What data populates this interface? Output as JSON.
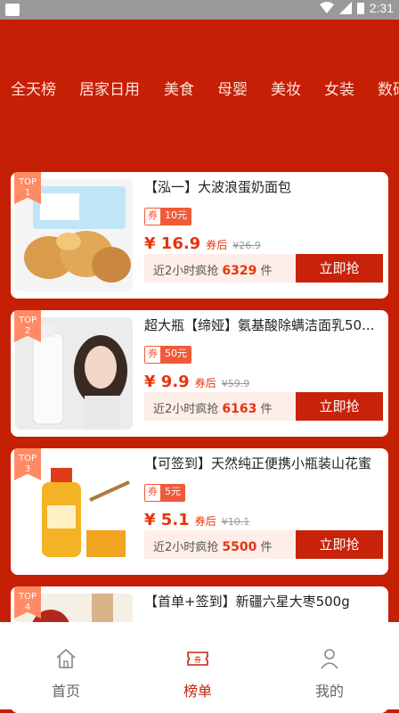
{
  "status_bar": {
    "time": "2:31"
  },
  "tabs": [
    "全天榜",
    "居家日用",
    "美食",
    "母婴",
    "美妆",
    "女装",
    "数码"
  ],
  "products": [
    {
      "rank": "1",
      "top_label": "TOP",
      "title": "【泓一】大波浪蛋奶面包",
      "coupon_label": "券",
      "coupon_value": "10元",
      "price": "¥ 16.9",
      "price_suffix": "券后",
      "original_price": "¥26.9",
      "sales_prefix": "近2小时疯抢",
      "sales_count": "6329",
      "sales_unit": "件",
      "buy_label": "立即抢"
    },
    {
      "rank": "2",
      "top_label": "TOP",
      "title": "超大瓶【缔娅】氨基酸除螨洁面乳50...",
      "coupon_label": "券",
      "coupon_value": "50元",
      "price": "¥ 9.9",
      "price_suffix": "券后",
      "original_price": "¥59.9",
      "sales_prefix": "近2小时疯抢",
      "sales_count": "6163",
      "sales_unit": "件",
      "buy_label": "立即抢"
    },
    {
      "rank": "3",
      "top_label": "TOP",
      "title": "【可签到】天然纯正便携小瓶装山花蜜",
      "coupon_label": "券",
      "coupon_value": "5元",
      "price": "¥ 5.1",
      "price_suffix": "券后",
      "original_price": "¥10.1",
      "sales_prefix": "近2小时疯抢",
      "sales_count": "5500",
      "sales_unit": "件",
      "buy_label": "立即抢"
    },
    {
      "rank": "4",
      "top_label": "TOP",
      "title": "【首单+签到】新疆六星大枣500g"
    }
  ],
  "bottom_nav": [
    {
      "label": "首页",
      "icon": "home-icon"
    },
    {
      "label": "榜单",
      "icon": "coupon-icon"
    },
    {
      "label": "我的",
      "icon": "user-icon"
    }
  ],
  "colors": {
    "header": "#c51f06",
    "accent": "#e8340c",
    "button": "#c8230a"
  }
}
